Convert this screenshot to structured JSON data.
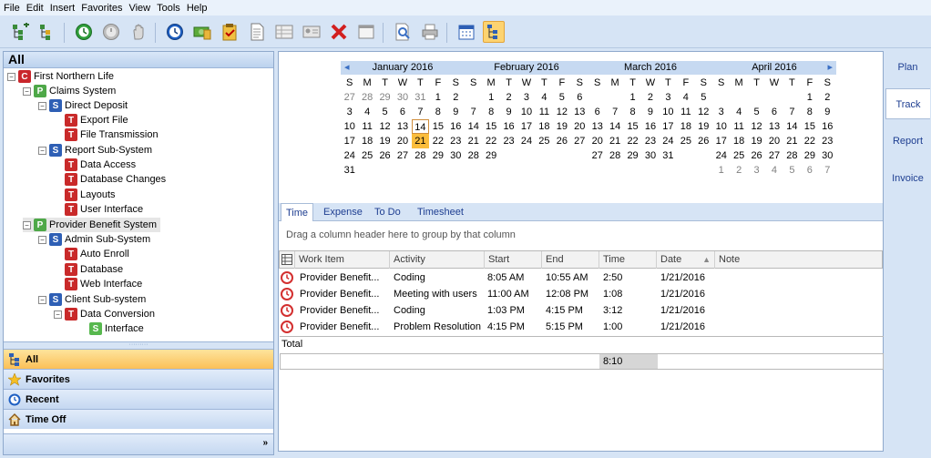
{
  "menu": [
    "File",
    "Edit",
    "Insert",
    "Favorites",
    "View",
    "Tools",
    "Help"
  ],
  "toolbar": {
    "buttons": [
      "add-project-icon",
      "add-subproject-icon",
      "start-timer-icon",
      "stop-timer-icon",
      "hand-icon",
      "clock-icon",
      "money-icon",
      "clipboard-icon",
      "document-icon",
      "table-icon",
      "card-icon",
      "delete-icon",
      "window-icon",
      "search-icon",
      "print-icon",
      "calendar-icon",
      "tree-view-icon"
    ]
  },
  "left_panel": {
    "header": "All",
    "tree": [
      {
        "label": "First Northern Life",
        "badge": "C"
      },
      {
        "label": "Claims System",
        "badge": "P"
      },
      {
        "label": "Direct Deposit",
        "badge": "S"
      },
      {
        "label": "Export File",
        "badge": "T"
      },
      {
        "label": "File Transmission",
        "badge": "T"
      },
      {
        "label": "Report Sub-System",
        "badge": "S"
      },
      {
        "label": "Data Access",
        "badge": "T"
      },
      {
        "label": "Database Changes",
        "badge": "T"
      },
      {
        "label": "Layouts",
        "badge": "T"
      },
      {
        "label": "User Interface",
        "badge": "T"
      },
      {
        "label": "Provider Benefit System",
        "badge": "P"
      },
      {
        "label": "Admin Sub-System",
        "badge": "S"
      },
      {
        "label": "Auto Enroll",
        "badge": "T"
      },
      {
        "label": "Database",
        "badge": "T"
      },
      {
        "label": "Web Interface",
        "badge": "T"
      },
      {
        "label": "Client Sub-system",
        "badge": "S"
      },
      {
        "label": "Data Conversion",
        "badge": "T"
      },
      {
        "label": "Interface",
        "badge": "S"
      }
    ],
    "nav": [
      "All",
      "Favorites",
      "Recent",
      "Time Off"
    ]
  },
  "calendars": [
    {
      "title": "January 2016",
      "days": [
        "27",
        "28",
        "29",
        "30",
        "31",
        "1",
        "2",
        "3",
        "4",
        "5",
        "6",
        "7",
        "8",
        "9",
        "10",
        "11",
        "12",
        "13",
        "14",
        "15",
        "16",
        "17",
        "18",
        "19",
        "20",
        "21",
        "22",
        "23",
        "24",
        "25",
        "26",
        "27",
        "28",
        "29",
        "30",
        "31"
      ],
      "grey_leading": 5,
      "grey_trailing": 0,
      "today": "14",
      "selected": "21"
    },
    {
      "title": "February 2016",
      "days": [
        "1",
        "2",
        "3",
        "4",
        "5",
        "6",
        "7",
        "8",
        "9",
        "10",
        "11",
        "12",
        "13",
        "14",
        "15",
        "16",
        "17",
        "18",
        "19",
        "20",
        "21",
        "22",
        "23",
        "24",
        "25",
        "26",
        "27",
        "28",
        "29"
      ],
      "lead_blank": 1
    },
    {
      "title": "March 2016",
      "days": [
        "1",
        "2",
        "3",
        "4",
        "5",
        "6",
        "7",
        "8",
        "9",
        "10",
        "11",
        "12",
        "13",
        "14",
        "15",
        "16",
        "17",
        "18",
        "19",
        "20",
        "21",
        "22",
        "23",
        "24",
        "25",
        "26",
        "27",
        "28",
        "29",
        "30",
        "31"
      ],
      "lead_blank": 2
    },
    {
      "title": "April 2016",
      "days": [
        "1",
        "2",
        "3",
        "4",
        "5",
        "6",
        "7",
        "8",
        "9",
        "10",
        "11",
        "12",
        "13",
        "14",
        "15",
        "16",
        "17",
        "18",
        "19",
        "20",
        "21",
        "22",
        "23",
        "24",
        "25",
        "26",
        "27",
        "28",
        "29",
        "30",
        "1",
        "2",
        "3",
        "4",
        "5",
        "6",
        "7"
      ],
      "lead_blank": 5,
      "grey_trailing": 7
    }
  ],
  "dow": [
    "S",
    "M",
    "T",
    "W",
    "T",
    "F",
    "S"
  ],
  "tabs": [
    "Time",
    "Expense",
    "To Do",
    "Timesheet"
  ],
  "group_hint": "Drag a column header here to group by that column",
  "grid": {
    "columns": [
      "Work Item",
      "Activity",
      "Start",
      "End",
      "Time",
      "Date",
      "Note"
    ],
    "rows": [
      {
        "work_item": "Provider Benefit...",
        "activity": "Coding",
        "start": "8:05 AM",
        "end": "10:55 AM",
        "time": "2:50",
        "date": "1/21/2016",
        "note": ""
      },
      {
        "work_item": "Provider Benefit...",
        "activity": "Meeting with users",
        "start": "11:00 AM",
        "end": "12:08 PM",
        "time": "1:08",
        "date": "1/21/2016",
        "note": ""
      },
      {
        "work_item": "Provider Benefit...",
        "activity": "Coding",
        "start": "1:03 PM",
        "end": "4:15 PM",
        "time": "3:12",
        "date": "1/21/2016",
        "note": ""
      },
      {
        "work_item": "Provider Benefit...",
        "activity": "Problem Resolution",
        "start": "4:15 PM",
        "end": "5:15 PM",
        "time": "1:00",
        "date": "1/21/2016",
        "note": ""
      }
    ],
    "total_label": "Total",
    "total_time": "8:10"
  },
  "right_tabs": [
    "Plan",
    "Track",
    "Report",
    "Invoice"
  ],
  "colors": {
    "accent": "#fbbd3c",
    "header_blue": "#c6d9f1",
    "link_blue": "#1e3e91",
    "timer_red": "#d32f2f"
  }
}
